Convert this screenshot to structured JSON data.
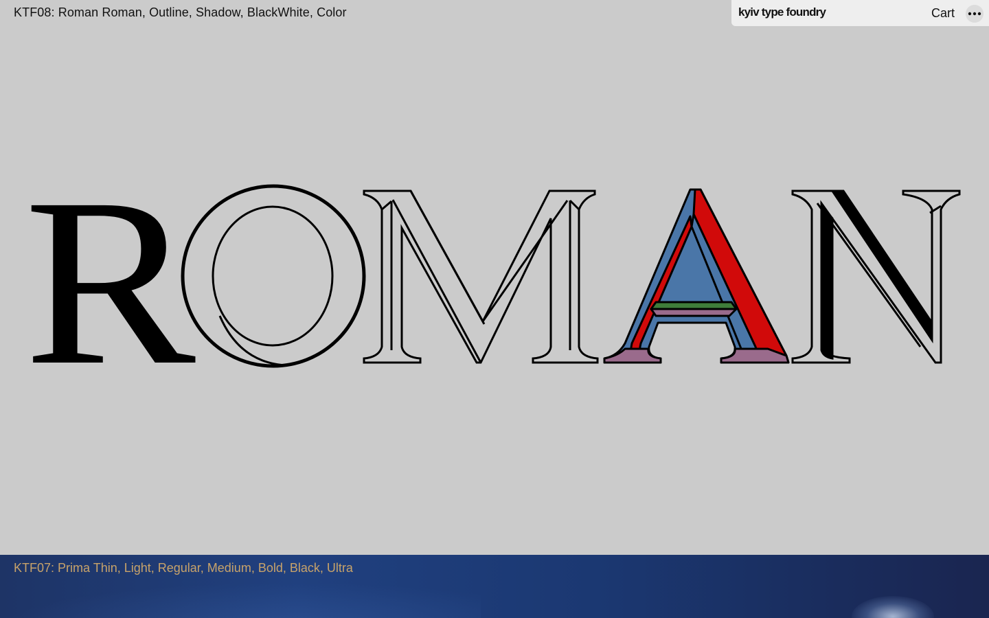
{
  "top_caption": "KTF08: Roman Roman, Outline, Shadow, BlackWhite, Color",
  "header": {
    "logo": "kyiv type foundry",
    "cart_label": "Cart",
    "menu_icon": "more-icon"
  },
  "hero": {
    "word": "ROMAN",
    "letter_styles": [
      "Roman",
      "Outline",
      "Shadow",
      "Color",
      "BlackWhite"
    ],
    "colors": {
      "black": "#000000",
      "blue": "#4a76a8",
      "red": "#d10a0a",
      "purple": "#9a6b8c",
      "green": "#3f7d3a",
      "background": "#cbcbcb"
    }
  },
  "bottom_caption": "KTF07: Prima Thin, Light, Regular, Medium, Bold, Black, Ultra",
  "bottom_caption_color": "#c8a36a"
}
